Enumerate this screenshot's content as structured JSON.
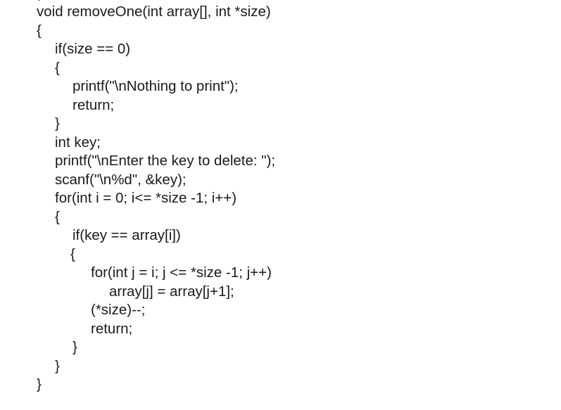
{
  "code": {
    "lines": [
      "void removeOne(int array[], int *size)",
      "{",
      "if(size == 0)",
      "{",
      "printf(\"\\nNothing to print\");",
      "return;",
      "}",
      "int key;",
      "printf(\"\\nEnter the key to delete: \");",
      "scanf(\"\\n%d\", &key);",
      "for(int i = 0; i<= *size -1; i++)",
      "{",
      "if(key == array[i])",
      "{",
      "for(int j = i; j <= *size -1; j++)",
      "array[j] = array[j+1];",
      "(*size)--;",
      "return;",
      "}",
      "}",
      "}"
    ]
  }
}
